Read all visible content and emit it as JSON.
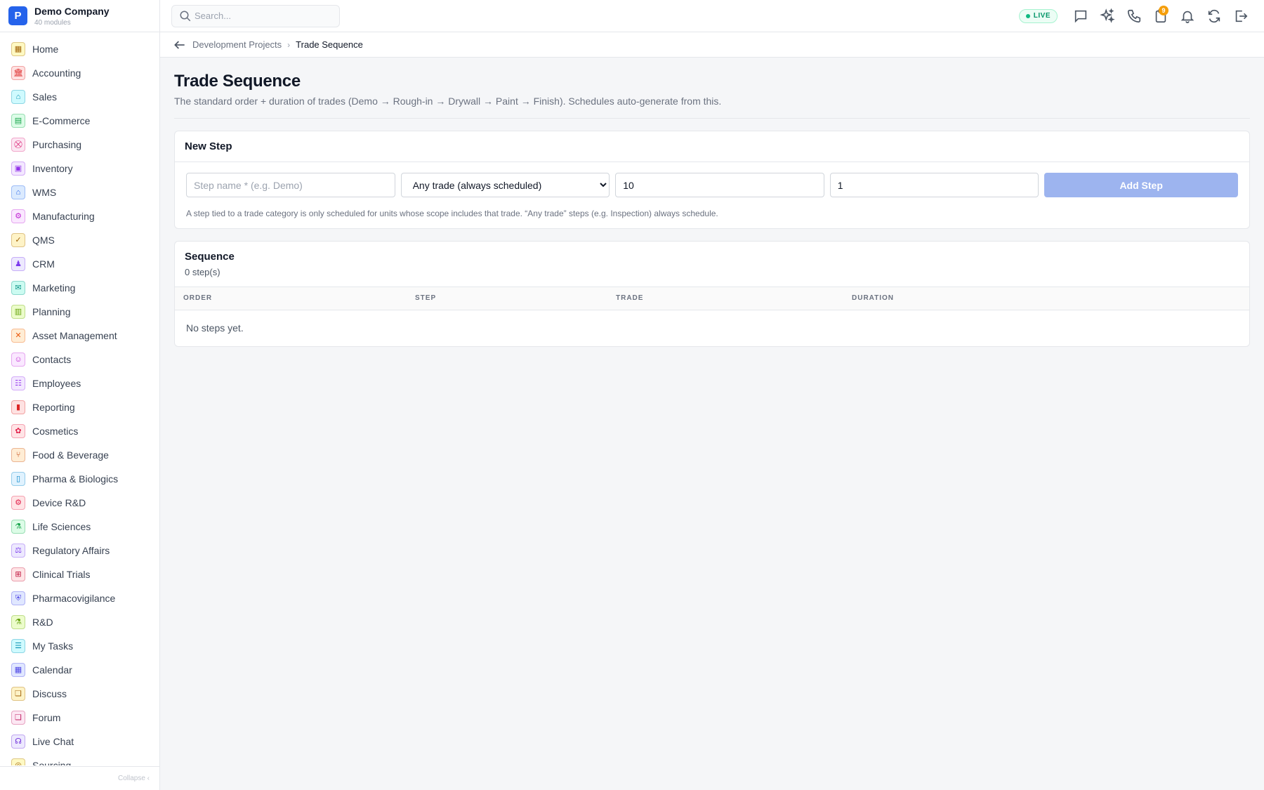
{
  "brand": {
    "logo_letter": "P",
    "name": "Demo Company",
    "sub": "40 modules"
  },
  "sidebar": {
    "items": [
      {
        "label": "Home",
        "icon": "▦",
        "color": "#a16207",
        "bg": "#fef9c3"
      },
      {
        "label": "Accounting",
        "icon": "🏛",
        "color": "#dc2626",
        "bg": "#fee2e2"
      },
      {
        "label": "Sales",
        "icon": "⌂",
        "color": "#0891b2",
        "bg": "#cffafe"
      },
      {
        "label": "E-Commerce",
        "icon": "▤",
        "color": "#16a34a",
        "bg": "#dcfce7"
      },
      {
        "label": "Purchasing",
        "icon": "⛒",
        "color": "#db2777",
        "bg": "#fce7f3"
      },
      {
        "label": "Inventory",
        "icon": "▣",
        "color": "#9333ea",
        "bg": "#f3e8ff"
      },
      {
        "label": "WMS",
        "icon": "⌂",
        "color": "#2563eb",
        "bg": "#dbeafe"
      },
      {
        "label": "Manufacturing",
        "icon": "⚙",
        "color": "#c026d3",
        "bg": "#fae8ff"
      },
      {
        "label": "QMS",
        "icon": "✓",
        "color": "#a16207",
        "bg": "#fef3c7"
      },
      {
        "label": "CRM",
        "icon": "♟",
        "color": "#7c3aed",
        "bg": "#ede9fe"
      },
      {
        "label": "Marketing",
        "icon": "✉",
        "color": "#0d9488",
        "bg": "#ccfbf1"
      },
      {
        "label": "Planning",
        "icon": "▥",
        "color": "#65a30d",
        "bg": "#ecfccb"
      },
      {
        "label": "Asset Management",
        "icon": "✕",
        "color": "#ea580c",
        "bg": "#ffedd5"
      },
      {
        "label": "Contacts",
        "icon": "☺",
        "color": "#c026d3",
        "bg": "#fae8ff"
      },
      {
        "label": "Employees",
        "icon": "☷",
        "color": "#9333ea",
        "bg": "#f3e8ff"
      },
      {
        "label": "Reporting",
        "icon": "▮",
        "color": "#dc2626",
        "bg": "#fee2e2"
      },
      {
        "label": "Cosmetics",
        "icon": "✿",
        "color": "#e11d48",
        "bg": "#ffe4e6"
      },
      {
        "label": "Food & Beverage",
        "icon": "⑂",
        "color": "#c2410c",
        "bg": "#ffedd5"
      },
      {
        "label": "Pharma & Biologics",
        "icon": "▯",
        "color": "#0284c7",
        "bg": "#e0f2fe"
      },
      {
        "label": "Device R&D",
        "icon": "⚙",
        "color": "#e11d48",
        "bg": "#ffe4e6"
      },
      {
        "label": "Life Sciences",
        "icon": "⚗",
        "color": "#16a34a",
        "bg": "#dcfce7"
      },
      {
        "label": "Regulatory Affairs",
        "icon": "⚖",
        "color": "#7c3aed",
        "bg": "#ede9fe"
      },
      {
        "label": "Clinical Trials",
        "icon": "⊞",
        "color": "#be123c",
        "bg": "#ffe4e6"
      },
      {
        "label": "Pharmacovigilance",
        "icon": "⛨",
        "color": "#4f46e5",
        "bg": "#e0e7ff"
      },
      {
        "label": "R&D",
        "icon": "⚗",
        "color": "#65a30d",
        "bg": "#ecfccb"
      },
      {
        "label": "My Tasks",
        "icon": "☰",
        "color": "#0891b2",
        "bg": "#cffafe"
      },
      {
        "label": "Calendar",
        "icon": "▦",
        "color": "#4f46e5",
        "bg": "#e0e7ff"
      },
      {
        "label": "Discuss",
        "icon": "❏",
        "color": "#a16207",
        "bg": "#fef3c7"
      },
      {
        "label": "Forum",
        "icon": "❏",
        "color": "#be185d",
        "bg": "#fce7f3"
      },
      {
        "label": "Live Chat",
        "icon": "☊",
        "color": "#6d28d9",
        "bg": "#ede9fe"
      },
      {
        "label": "Sourcing",
        "icon": "◎",
        "color": "#a16207",
        "bg": "#fef9c3"
      }
    ],
    "collapse_label": "Collapse ‹"
  },
  "topbar": {
    "search_placeholder": "Search...",
    "live_label": "LIVE",
    "notif_count": "9"
  },
  "breadcrumb": {
    "parent": "Development Projects",
    "sep": "›",
    "current": "Trade Sequence"
  },
  "page": {
    "title": "Trade Sequence",
    "subtitle": "The standard order + duration of trades (Demo → Rough-in → Drywall → Paint → Finish). Schedules auto-generate from this."
  },
  "new_step": {
    "title": "New Step",
    "name_placeholder": "Step name * (e.g. Demo)",
    "trade_selected": "Any trade (always scheduled)",
    "order_value": "10",
    "duration_value": "1",
    "add_label": "Add Step",
    "help": "A step tied to a trade category is only scheduled for units whose scope includes that trade. “Any trade” steps (e.g. Inspection) always schedule."
  },
  "sequence": {
    "title": "Sequence",
    "count": "0 step(s)",
    "columns": [
      "ORDER",
      "STEP",
      "TRADE",
      "DURATION"
    ],
    "empty": "No steps yet."
  },
  "colors": {
    "accent": "#2563eb",
    "add_button": "#9db4ef",
    "live": "#059669"
  }
}
